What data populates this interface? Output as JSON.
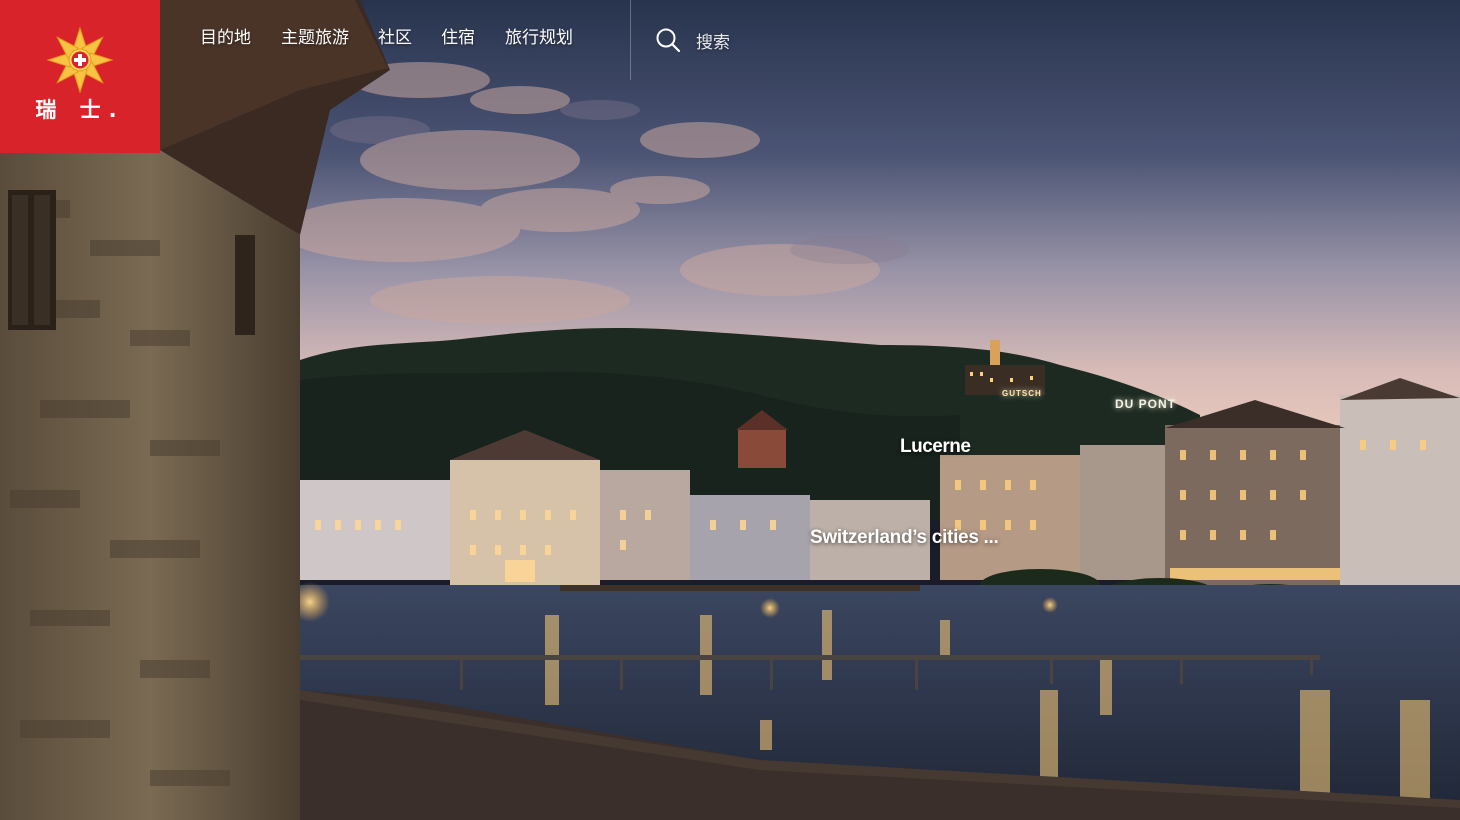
{
  "brand": {
    "name": "瑞 士.",
    "logo_icon": "edelweiss-swiss-cross-icon",
    "color": "#d8232a"
  },
  "nav": {
    "items": [
      {
        "label": "目的地"
      },
      {
        "label": "主题旅游"
      },
      {
        "label": "社区"
      },
      {
        "label": "住宿"
      },
      {
        "label": "旅行规划"
      }
    ]
  },
  "search": {
    "icon": "search-icon",
    "label": "搜索"
  },
  "hero": {
    "city_caption": "Lucerne",
    "tagline": "Switzerland’s cities ...",
    "signs": {
      "dupont": "DU PONT",
      "gutsch": "GUTSCH"
    }
  },
  "colors": {
    "sky_top": "#2c3752",
    "sky_horizon": "#e0c3bc",
    "water": "#2a3548",
    "stone_tower": "#6e5f4a"
  }
}
